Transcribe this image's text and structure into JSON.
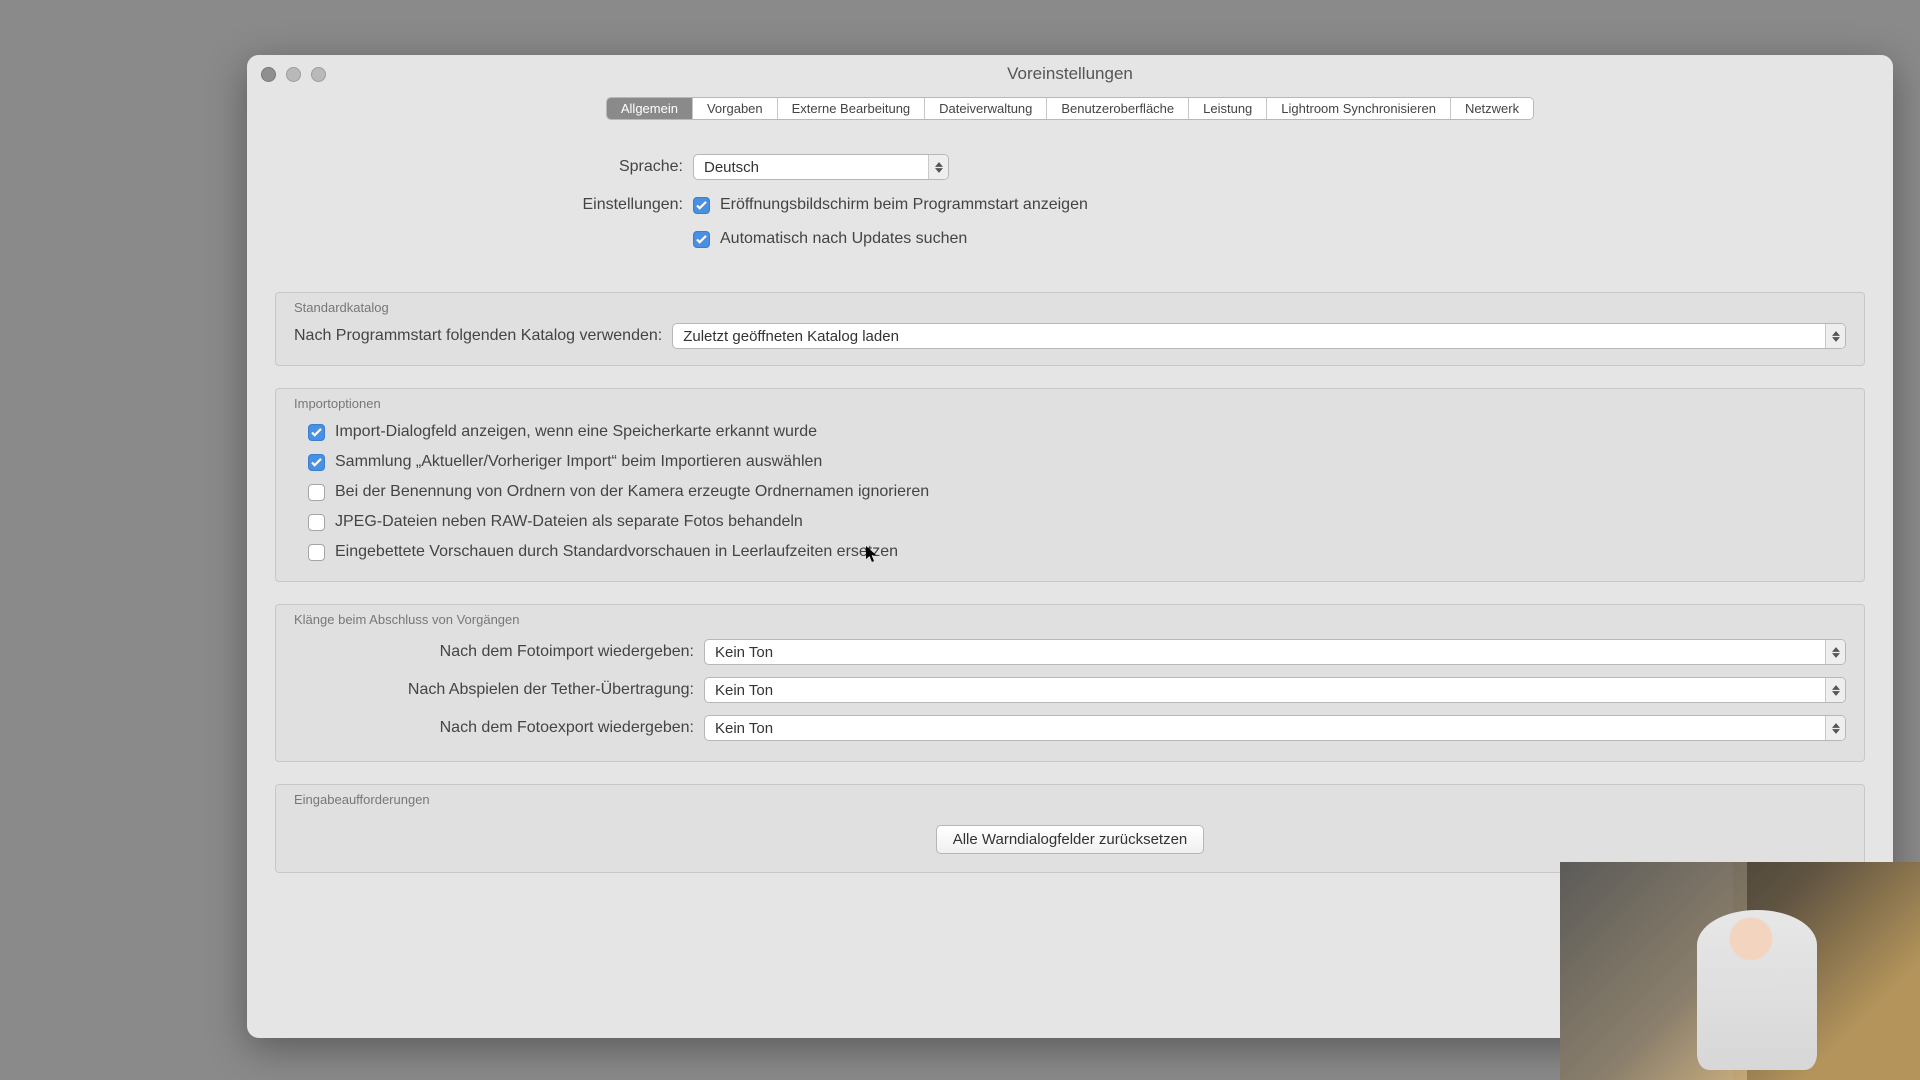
{
  "window": {
    "title": "Voreinstellungen"
  },
  "tabs": [
    {
      "id": "general",
      "label": "Allgemein",
      "active": true
    },
    {
      "id": "presets",
      "label": "Vorgaben"
    },
    {
      "id": "external",
      "label": "Externe Bearbeitung"
    },
    {
      "id": "filehdl",
      "label": "Dateiverwaltung"
    },
    {
      "id": "ui",
      "label": "Benutzeroberfläche"
    },
    {
      "id": "perf",
      "label": "Leistung"
    },
    {
      "id": "lrsync",
      "label": "Lightroom Synchronisieren"
    },
    {
      "id": "network",
      "label": "Netzwerk"
    }
  ],
  "general": {
    "language_label": "Sprache:",
    "language_value": "Deutsch",
    "settings_label": "Einstellungen:",
    "splash": {
      "checked": true,
      "label": "Eröffnungsbildschirm beim Programmstart anzeigen"
    },
    "updates": {
      "checked": true,
      "label": "Automatisch nach Updates suchen"
    }
  },
  "catalog": {
    "section_title": "Standardkatalog",
    "label": "Nach Programmstart folgenden Katalog verwenden:",
    "value": "Zuletzt geöffneten Katalog laden"
  },
  "import": {
    "section_title": "Importoptionen",
    "opts": [
      {
        "checked": true,
        "label": "Import-Dialogfeld anzeigen, wenn eine Speicherkarte erkannt wurde"
      },
      {
        "checked": true,
        "label": "Sammlung „Aktueller/Vorheriger Import“ beim Importieren auswählen"
      },
      {
        "checked": false,
        "label": "Bei der Benennung von Ordnern von der Kamera erzeugte Ordnernamen ignorieren"
      },
      {
        "checked": false,
        "label": "JPEG-Dateien neben RAW-Dateien als separate Fotos behandeln"
      },
      {
        "checked": false,
        "label": "Eingebettete Vorschauen durch Standardvorschauen in Leerlaufzeiten ersetzen"
      }
    ]
  },
  "sounds": {
    "section_title": "Klänge beim Abschluss von Vorgängen",
    "rows": [
      {
        "label": "Nach dem Fotoimport wiedergeben:",
        "value": "Kein Ton"
      },
      {
        "label": "Nach Abspielen der Tether-Übertragung:",
        "value": "Kein Ton"
      },
      {
        "label": "Nach dem Fotoexport wiedergeben:",
        "value": "Kein Ton"
      }
    ]
  },
  "prompts": {
    "section_title": "Eingabeaufforderungen",
    "reset_button": "Alle Warndialogfelder zurücksetzen"
  }
}
